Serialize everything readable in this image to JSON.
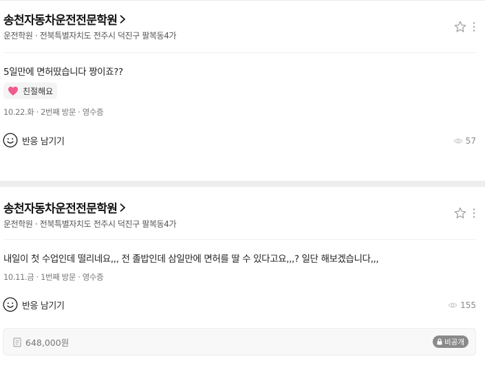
{
  "reviews": [
    {
      "place_name": "송천자동차운전전문학원",
      "place_info": "운전학원 · 전북특별자치도 전주시 덕진구 팔복동4가",
      "text": "5일만에 면허땄습니다 짱이죠??",
      "tag_label": "친절해요",
      "meta": "10.22.화 · 2번째 방문 · 영수증",
      "react_label": "반응 남기기",
      "views": "57"
    },
    {
      "place_name": "송천자동차운전전문학원",
      "place_info": "운전학원 · 전북특별자치도 전주시 덕진구 팔복동4가",
      "text": "내일이 첫 수업인데 떨리네요,,, 전 졸밥인데 삼일만에 면허를 딸 수 있다고요,,,? 일단 해보겠습니다,,,",
      "meta": "10.11.금 · 1번째 방문 · 영수증",
      "react_label": "반응 남기기",
      "views": "155",
      "receipt_amount": "648,000원",
      "private_label": "비공개"
    }
  ],
  "icons": {
    "chevron": "chevron-right-icon",
    "star": "star-outline-icon",
    "more": "more-vertical-icon",
    "heart": "heart-icon",
    "smile": "smile-icon",
    "eye": "eye-icon",
    "receipt": "receipt-icon",
    "lock": "lock-icon"
  },
  "colors": {
    "heart": "#f05a8c",
    "private_badge": "#8a8a8a"
  }
}
